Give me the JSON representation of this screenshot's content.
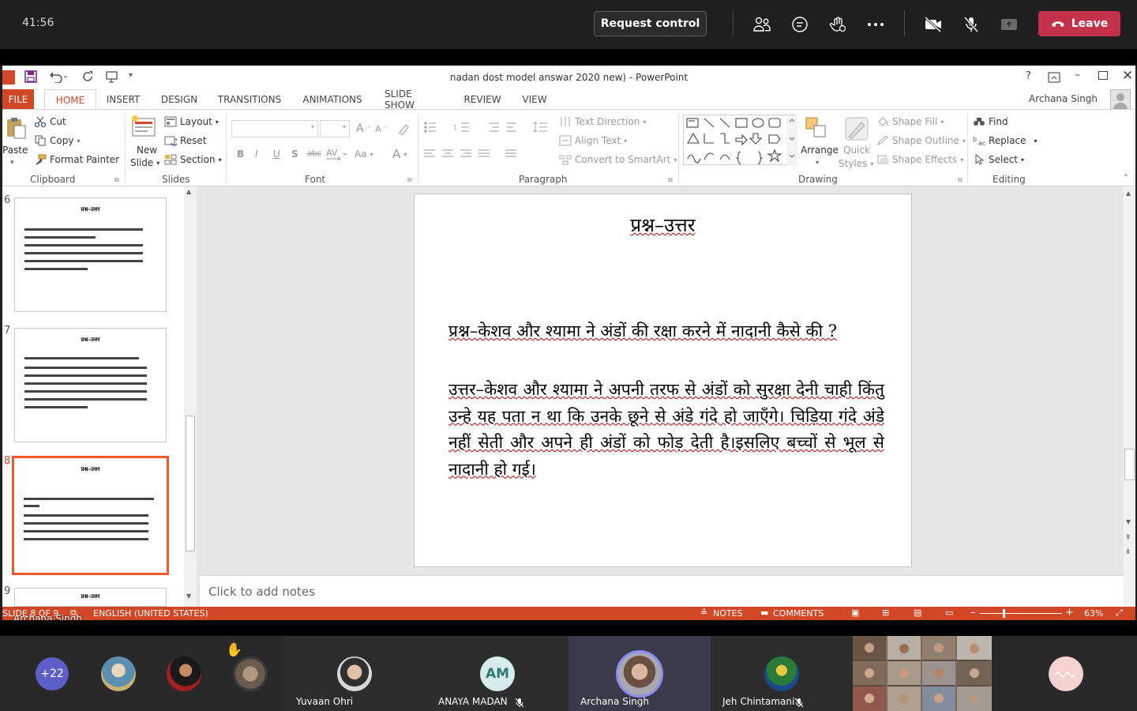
{
  "meeting": {
    "timer": "41:56",
    "request_control": "Request control",
    "leave": "Leave",
    "colors": {
      "leave": "#c4314b",
      "accent_orange": "#d24726"
    }
  },
  "ppt": {
    "title": "nadan dost model answar 2020 new) - PowerPoint",
    "help": "?",
    "user": "Archana Singh",
    "tabs": [
      "FILE",
      "HOME",
      "INSERT",
      "DESIGN",
      "TRANSITIONS",
      "ANIMATIONS",
      "SLIDE SHOW",
      "REVIEW",
      "VIEW"
    ],
    "ribbon": {
      "clipboard": {
        "paste": "Paste",
        "cut": "Cut",
        "copy": "Copy",
        "format_painter": "Format Painter",
        "label": "Clipboard"
      },
      "slides": {
        "new_slide_1": "New",
        "new_slide_2": "Slide",
        "layout": "Layout",
        "reset": "Reset",
        "section": "Section",
        "label": "Slides"
      },
      "font": {
        "bold": "B",
        "italic": "I",
        "underline": "U",
        "shadow": "S",
        "strike": "abc",
        "case": "Aa",
        "color": "A",
        "grow": "A",
        "shrink": "A",
        "label": "Font"
      },
      "paragraph": {
        "text_direction": "Text Direction",
        "align_text": "Align Text",
        "smartart": "Convert to SmartArt",
        "label": "Paragraph"
      },
      "drawing": {
        "arrange": "Arrange",
        "quick_styles_1": "Quick",
        "quick_styles_2": "Styles",
        "shape_fill": "Shape Fill",
        "shape_outline": "Shape Outline",
        "shape_effects": "Shape Effects",
        "label": "Drawing"
      },
      "editing": {
        "find": "Find",
        "replace": "Replace",
        "select": "Select",
        "label": "Editing"
      }
    },
    "thumbnails": [
      {
        "num": "6",
        "title": "प्रश्न–उत्तर"
      },
      {
        "num": "7",
        "title": "प्रश्न–उत्तर"
      },
      {
        "num": "8",
        "title": "प्रश्न–उत्तर"
      },
      {
        "num": "9",
        "title": "प्रश्न–उत्तर"
      }
    ],
    "slide": {
      "title": "प्रश्न–उत्तर",
      "question": "प्रश्न–केशव और श्यामा ने अंडों की रक्षा करने में नादानी कैसे की ?",
      "answer": "उत्तर–केशव और श्यामा ने अपनी तरफ से अंडों को सुरक्षा देनी चाही किंतु उन्हे यह पता न था कि उनके छूने से अंडे गंदे हो जाएँगे। चिड़िया गंदे अंडे नहीं सेती और अपने ही अंडों को फोड़ देती है।इसलिए बच्चों से भूल से नादानी हो गई।"
    },
    "notes_placeholder": "Click to add notes",
    "status": {
      "slide_of": "SLIDE 8 OF 9",
      "language": "ENGLISH (UNITED STATES)",
      "notes": "NOTES",
      "comments": "COMMENTS",
      "zoom": "63%"
    }
  },
  "presenter_caption": "Archana Singh",
  "participants": {
    "overflow": "+22",
    "tiles": [
      {
        "name": "Yuvaan Ohri"
      },
      {
        "name": "ANAYA MADAN",
        "initials": "AM"
      },
      {
        "name": "Archana Singh"
      },
      {
        "name": "Jeh Chintamani"
      }
    ],
    "hand_emoji": "✋"
  }
}
